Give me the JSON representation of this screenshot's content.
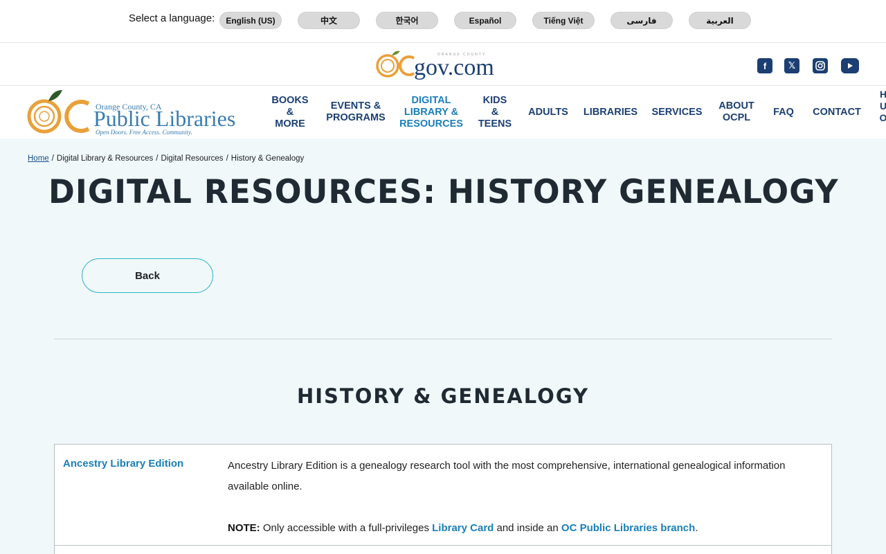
{
  "language_bar": {
    "label": "Select a language:",
    "languages": [
      "English (US)",
      "中文",
      "한국어",
      "Español",
      "Tiếng Việt",
      "فارسی",
      "العربية"
    ]
  },
  "ocgov": {
    "logo_text": "OCgov.com",
    "logo_sub": "ORANGE COUNTY",
    "social": [
      "facebook-icon",
      "x-icon",
      "instagram-icon",
      "youtube-icon"
    ]
  },
  "library_logo": {
    "county": "Orange County, CA",
    "name": "Public Libraries",
    "tagline": "Open Doors. Free Access. Community."
  },
  "nav": {
    "items": [
      {
        "label": "BOOKS & MORE"
      },
      {
        "label": "EVENTS & PROGRAMS"
      },
      {
        "label": "DIGITAL LIBRARY & RESOURCES"
      },
      {
        "label": "KIDS & TEENS"
      },
      {
        "label": "ADULTS"
      },
      {
        "label": "LIBRARIES"
      },
      {
        "label": "SERVICES"
      },
      {
        "label": "ABOUT OCPL"
      },
      {
        "label": "FAQ"
      },
      {
        "label": "CONTACT"
      }
    ],
    "overflow": "H\nU\nO"
  },
  "breadcrumb": [
    "Home",
    "Digital Library & Resources",
    "Digital Resources",
    "History & Genealogy"
  ],
  "page_title": "DIGITAL RESOURCES: HISTORY GENEALOGY",
  "back_label": "Back",
  "section_title": "HISTORY & GENEALOGY",
  "resources": [
    {
      "name": "Ancestry Library Edition",
      "description": "Ancestry Library Edition is a genealogy research tool with the most comprehensive, international genealogical information available online.",
      "note_label": "NOTE:",
      "note_pre": "Only accessible with a full-privileges",
      "note_link1": "Library Card",
      "note_mid": "and inside an",
      "note_link2": "OC Public Libraries branch",
      "note_end": "."
    }
  ],
  "colors": {
    "brand_navy": "#1b3f73",
    "link_blue": "#1a7fb8",
    "orange": "#e8a13a",
    "teal": "#27b5c4",
    "page_bg": "#f0f8fa"
  }
}
